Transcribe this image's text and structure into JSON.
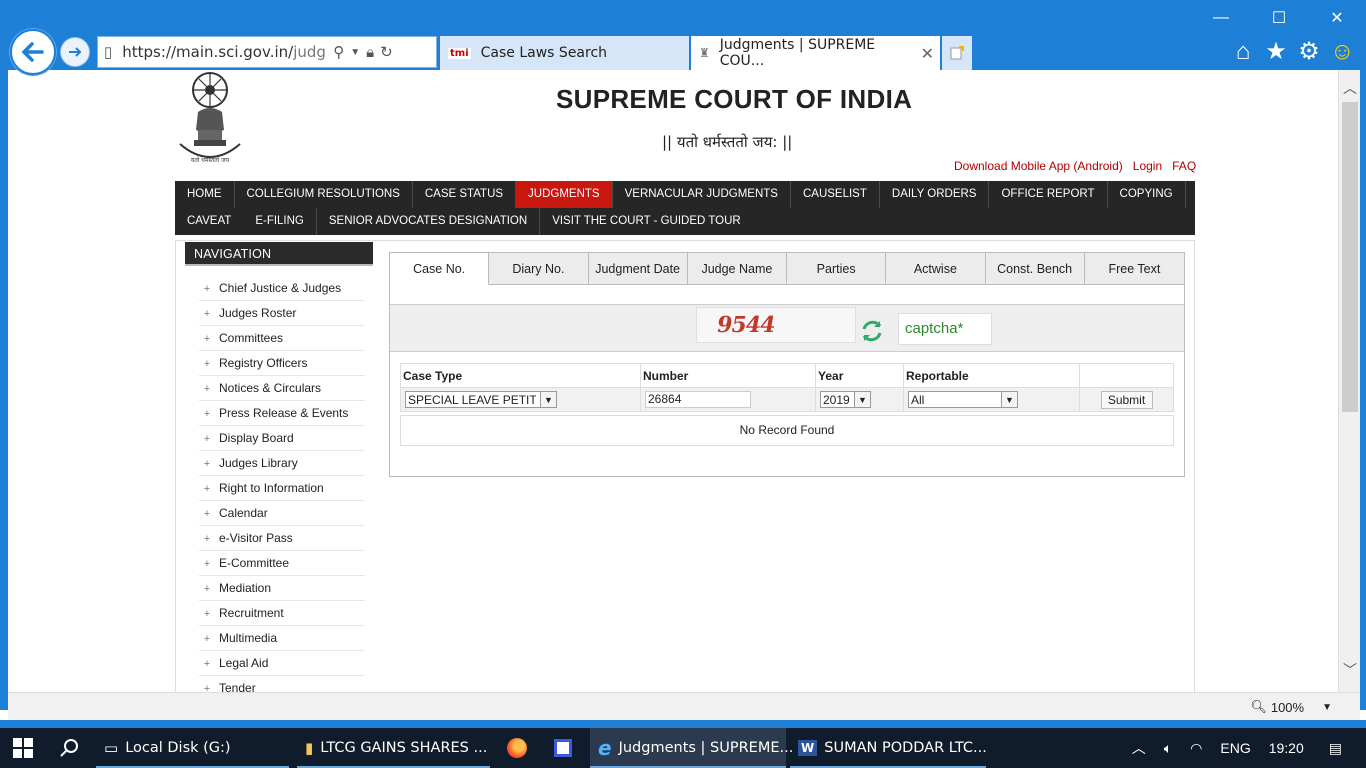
{
  "browser": {
    "window_controls": {
      "minimize": "—",
      "maximize": "☐",
      "close": "✕"
    },
    "url_main": "https://main.sci.gov.in/",
    "url_rest": "judgme",
    "tabs": [
      {
        "label": "Case Laws Search",
        "favicon": "tmi"
      },
      {
        "label": "Judgments | SUPREME COU...",
        "favicon": "emblem"
      }
    ],
    "toolbar": {
      "home_icon": "⌂",
      "star_icon": "★",
      "gear_icon": "⚙",
      "smiley_icon": "☺"
    }
  },
  "site": {
    "title": "SUPREME COURT OF INDIA",
    "motto": "|| यतो धर्मस्ततो जय: ||",
    "top_links": [
      "Download Mobile App (Android)",
      "Login",
      "FAQ"
    ]
  },
  "main_nav": [
    "HOME",
    "COLLEGIUM RESOLUTIONS",
    "CASE STATUS",
    "JUDGMENTS",
    "VERNACULAR JUDGMENTS",
    "CAUSELIST",
    "DAILY ORDERS",
    "OFFICE REPORT",
    "COPYING",
    "CAVEAT",
    "E-FILING",
    "SENIOR ADVOCATES DESIGNATION",
    "VISIT THE COURT - GUIDED TOUR"
  ],
  "navigation": {
    "header": "NAVIGATION",
    "items": [
      "Chief Justice & Judges",
      "Judges Roster",
      "Committees",
      "Registry Officers",
      "Notices & Circulars",
      "Press Release & Events",
      "Display Board",
      "Judges Library",
      "Right to Information",
      "Calendar",
      "e-Visitor Pass",
      "E-Committee",
      "Mediation",
      "Recruitment",
      "Multimedia",
      "Legal Aid",
      "Tender"
    ]
  },
  "search": {
    "tabs": [
      "Case No.",
      "Diary No.",
      "Judgment Date",
      "Judge Name",
      "Parties",
      "Actwise",
      "Const. Bench",
      "Free Text"
    ],
    "captcha_code": "9544",
    "captcha_placeholder": "captcha*",
    "columns": [
      "Case Type",
      "Number",
      "Year",
      "Reportable",
      ""
    ],
    "case_type": "SPECIAL LEAVE PETITION",
    "number": "26864",
    "year": "2019",
    "reportable": "All",
    "submit": "Submit",
    "result": "No Record Found"
  },
  "statusbar": {
    "zoom": "100%"
  },
  "taskbar": {
    "items": [
      {
        "label": "Local Disk (G:)",
        "icon": "▭"
      },
      {
        "label": "LTCG GAINS SHARES ...",
        "icon": "▮"
      },
      {
        "label": "Judgments | SUPREME...",
        "icon": "e"
      },
      {
        "label": "SUMAN PODDAR LTC...",
        "icon": "W"
      }
    ],
    "language": "ENG",
    "time": "19:20"
  }
}
